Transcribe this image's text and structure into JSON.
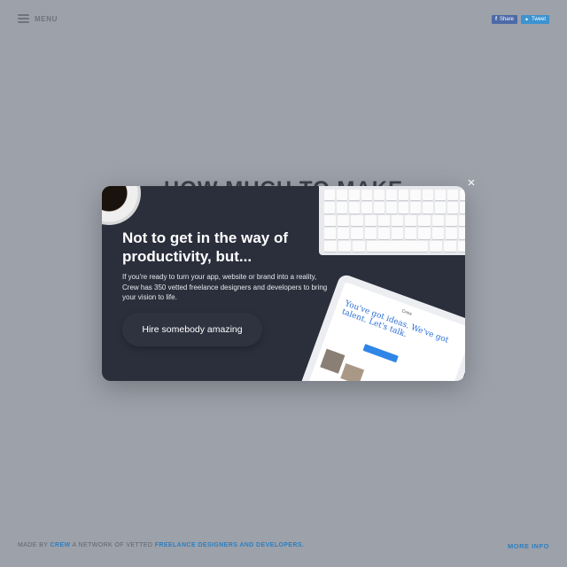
{
  "header": {
    "menu_label": "MENU"
  },
  "social": {
    "share_label": "Share",
    "tweet_label": "Tweet"
  },
  "background": {
    "headline": "HOW MUCH TO MAKE"
  },
  "modal": {
    "title": "Not to get in the way of productivity, but...",
    "body": "If you're ready to turn your app, website or brand into a reality, Crew has 350 vetted freelance designers and developers to bring your vision to life.",
    "cta_label": "Hire somebody amazing",
    "close_label": "×",
    "tablet_logo": "Crew",
    "tablet_text": "You've got ideas. We've got talent. Let's talk."
  },
  "footer": {
    "made_by": "MADE BY",
    "crew": "CREW",
    "network_text": "A NETWORK OF VETTED",
    "freelance_link": "FREELANCE DESIGNERS AND DEVELOPERS.",
    "more_info": "MORE INFO"
  }
}
